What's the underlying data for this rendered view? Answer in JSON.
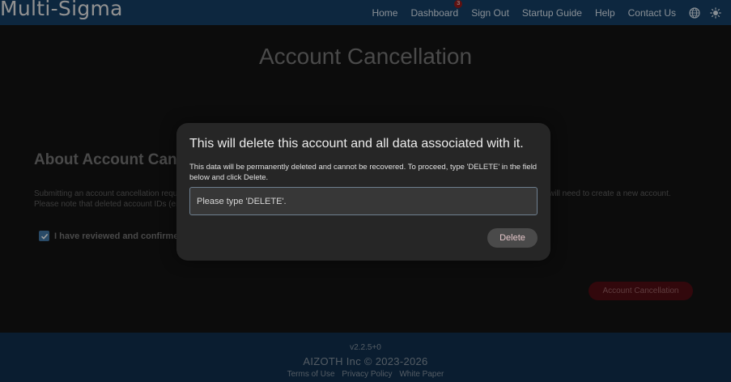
{
  "navbar": {
    "brand": "Multi-Sigma",
    "links": {
      "home": "Home",
      "dashboard": "Dashboard",
      "dashboard_badge": "3",
      "sign_out": "Sign Out",
      "startup_guide": "Startup Guide",
      "help": "Help",
      "contact_us": "Contact Us"
    },
    "icons": [
      "globe-icon",
      "sun-icon"
    ]
  },
  "page": {
    "title": "Account Cancellation",
    "section_title": "About Account Cancel",
    "desc_line1": "Submitting an account cancellation requ",
    "desc_line2": "Please note that deleted account IDs (er",
    "desc_right": "will need to create a new account.",
    "checkbox_label": "I have reviewed and confirmed",
    "checkbox_checked": true,
    "cancel_button": "Account Cancellation"
  },
  "modal": {
    "title": "This will delete this account and all data associated with it.",
    "text": "This data will be permanently deleted and cannot be recovered. To proceed, type 'DELETE' in the field below and click Delete.",
    "input_placeholder": "Please type 'DELETE'.",
    "input_value": "",
    "delete_button": "Delete"
  },
  "footer": {
    "version": "v2.2.5+0",
    "copyright": "AIZOTH Inc © 2023-2026",
    "links": {
      "terms": "Terms of Use",
      "privacy": "Privacy Policy",
      "white_paper": "White Paper"
    }
  },
  "colors": {
    "navbar_bg": "#143a5e",
    "footer_bg": "#0f2c48",
    "modal_bg": "#262626",
    "danger": "#4a0c12",
    "accent": "#3d6e98"
  }
}
